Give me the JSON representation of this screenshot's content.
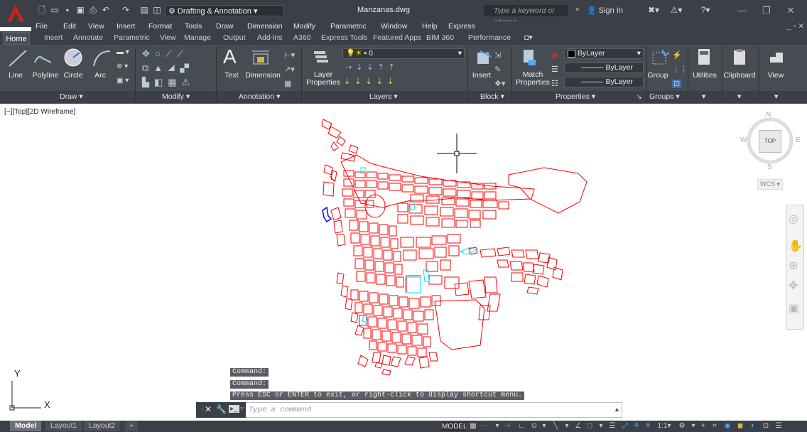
{
  "app": {
    "title": "Manzanas.dwg",
    "workspace": "Drafting & Annotation",
    "search_placeholder": "Type a keyword or phrase",
    "sign_in": "Sign In"
  },
  "menu": [
    "File",
    "Edit",
    "View",
    "Insert",
    "Format",
    "Tools",
    "Draw",
    "Dimension",
    "Modify",
    "Parametric",
    "Window",
    "Help",
    "Express"
  ],
  "tabs": [
    "Home",
    "Insert",
    "Annotate",
    "Parametric",
    "View",
    "Manage",
    "Output",
    "Add-ins",
    "A360",
    "Express Tools",
    "Featured Apps",
    "BIM 360",
    "Performance"
  ],
  "ribbon": {
    "draw": {
      "line": "Line",
      "polyline": "Polyline",
      "circle": "Circle",
      "arc": "Arc",
      "title": "Draw"
    },
    "modify": {
      "title": "Modify"
    },
    "annotation": {
      "text": "Text",
      "dimension": "Dimension",
      "title": "Annotation"
    },
    "layers": {
      "layer_properties_1": "Layer",
      "layer_properties_2": "Properties",
      "current_layer": "0",
      "title": "Layers"
    },
    "block": {
      "insert": "Insert",
      "title": "Block"
    },
    "properties": {
      "match_1": "Match",
      "match_2": "Properties",
      "color": "ByLayer",
      "linetype": "ByLayer",
      "lineweight": "ByLayer",
      "title": "Properties"
    },
    "groups": {
      "group": "Group",
      "title": "Groups"
    },
    "utilities": "Utilities",
    "clipboard": "Clipboard",
    "view": "View"
  },
  "viewport": {
    "label": "[−][Top][2D Wireframe]"
  },
  "viewcube": {
    "n": "N",
    "s": "S",
    "e": "E",
    "w": "W",
    "top": "TOP",
    "wcs": "WCS"
  },
  "ucs": {
    "x": "X",
    "y": "Y"
  },
  "command": {
    "history": [
      "Command:",
      "Command:",
      "Press ESC or ENTER to exit, or right-click to display shortcut menu."
    ],
    "placeholder": "Type a command"
  },
  "layouts": [
    "Model",
    "Layout1",
    "Layout2"
  ],
  "status": {
    "model": "MODEL",
    "scale": "1:1"
  },
  "colors": {
    "accent": "#cc0000",
    "drawing_red": "#ff0000",
    "drawing_cyan": "#00e5ff",
    "drawing_blue": "#0000ff",
    "ribbon_bg": "#474b52",
    "titlebar_bg": "#3b3f47"
  }
}
